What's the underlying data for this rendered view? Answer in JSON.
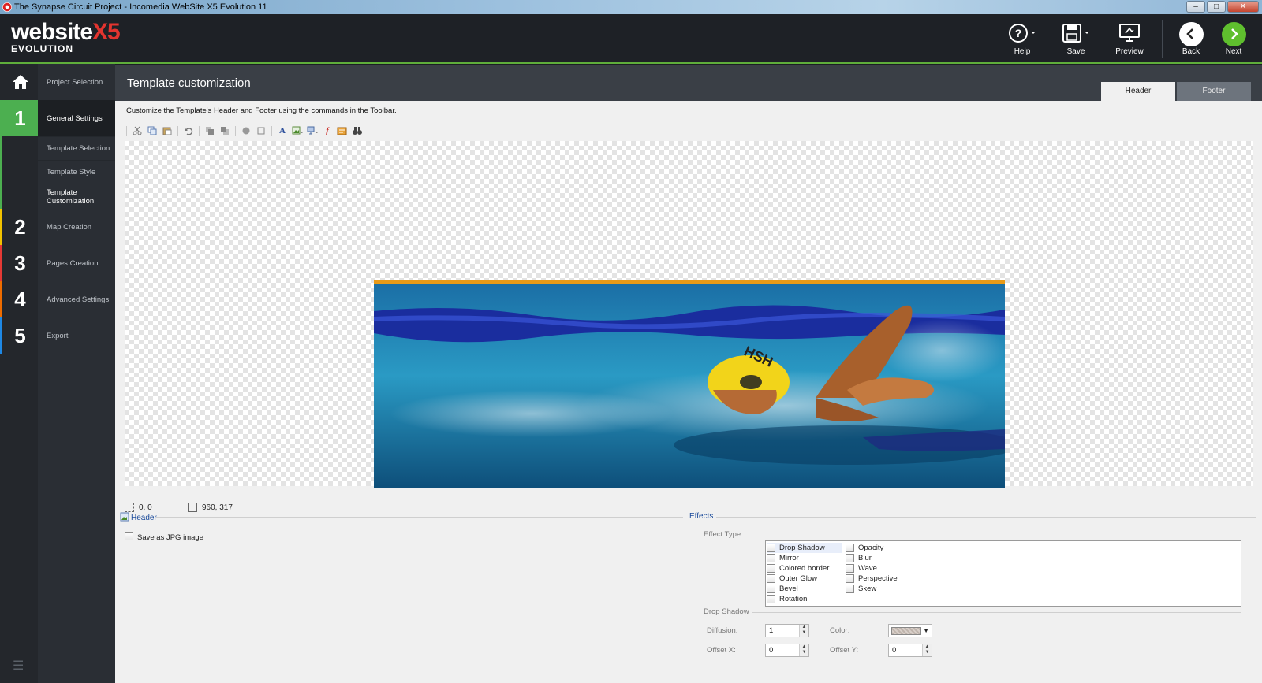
{
  "window": {
    "title": "The Synapse Circuit Project - Incomedia WebSite X5 Evolution 11"
  },
  "logo": {
    "main": "website",
    "x5": "X5",
    "sub": "EVOLUTION"
  },
  "toolbar_top": {
    "help": "Help",
    "save": "Save",
    "preview": "Preview",
    "back": "Back",
    "next": "Next"
  },
  "sidebar": {
    "home_label": "Project Selection",
    "steps": [
      {
        "num": "1",
        "label": "General Settings",
        "color": "#4caf50"
      },
      {
        "num": "2",
        "label": "Map Creation",
        "color": "#f2c200"
      },
      {
        "num": "3",
        "label": "Pages Creation",
        "color": "#e53935"
      },
      {
        "num": "4",
        "label": "Advanced Settings",
        "color": "#ef6c00"
      },
      {
        "num": "5",
        "label": "Export",
        "color": "#1e88e5"
      }
    ],
    "subitems": [
      "Template Selection",
      "Template Style",
      "Template Customization"
    ]
  },
  "main": {
    "title": "Template customization",
    "tabs": [
      "Header",
      "Footer"
    ],
    "description": "Customize the Template's Header and Footer using the commands in the Toolbar.",
    "position": "0, 0",
    "size": "960, 317",
    "header_section": "Header",
    "save_jpg": "Save as JPG image",
    "effects_section": "Effects",
    "effect_type_label": "Effect Type:",
    "effects_col1": [
      "Drop Shadow",
      "Mirror",
      "Colored border",
      "Outer Glow",
      "Bevel",
      "Rotation"
    ],
    "effects_col2": [
      "Opacity",
      "Blur",
      "Wave",
      "Perspective",
      "Skew"
    ],
    "drop_shadow_section": "Drop Shadow",
    "diffusion_label": "Diffusion:",
    "diffusion_value": "1",
    "color_label": "Color:",
    "offset_x_label": "Offset X:",
    "offset_x_value": "0",
    "offset_y_label": "Offset Y:",
    "offset_y_value": "0"
  },
  "colors": {
    "accent_green": "#5fae3b",
    "banner_orange": "#e89a18"
  }
}
